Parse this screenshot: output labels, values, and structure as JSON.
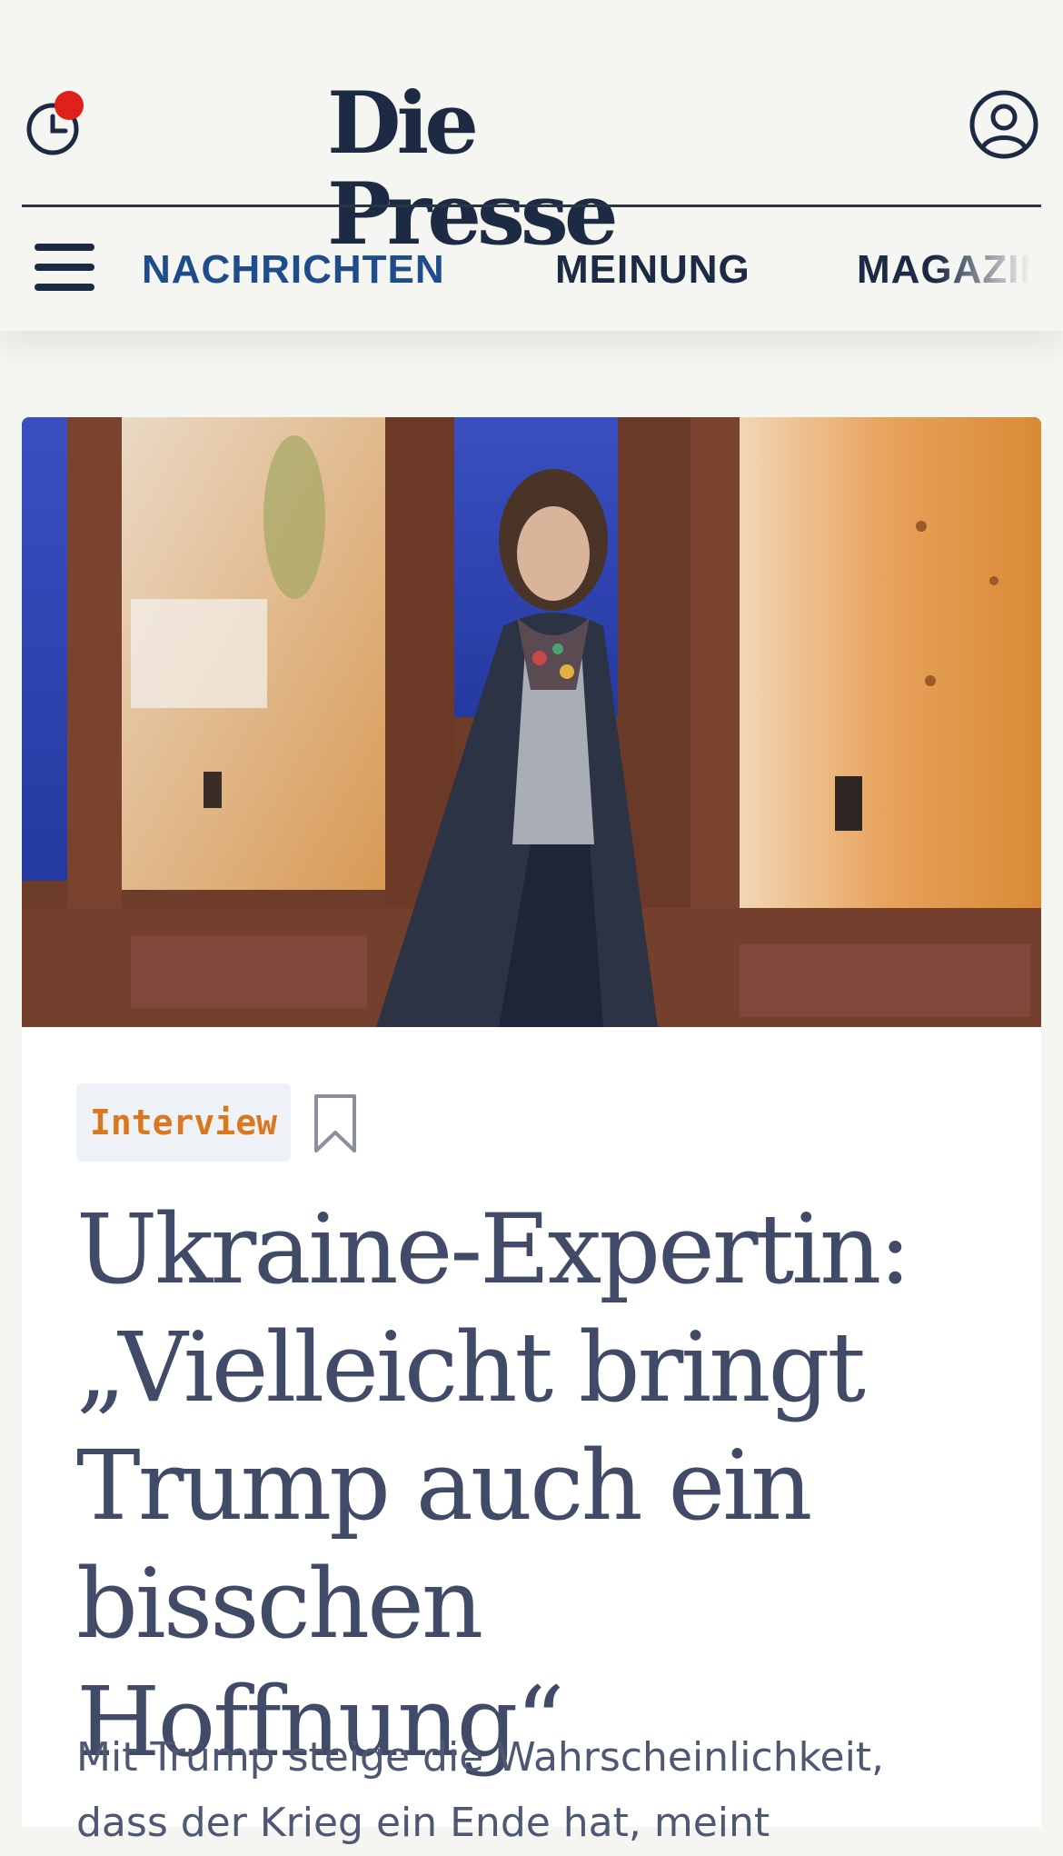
{
  "header": {
    "logo": "Die Presse",
    "icons": {
      "history": "clock-icon",
      "account": "user-circle-icon",
      "menu": "hamburger-menu-icon"
    },
    "colors": {
      "brand": "#1d2a44",
      "notification": "#e0201b",
      "active_nav": "#1f4d8c"
    }
  },
  "nav": {
    "items": [
      {
        "label": "NACHRICHTEN",
        "active": true
      },
      {
        "label": "MEINUNG",
        "active": false
      },
      {
        "label": "MAGAZIN",
        "active": false
      }
    ]
  },
  "article": {
    "tag": "Interview",
    "tag_color": "#d9781f",
    "bookmark_icon": "bookmark-icon",
    "headline": "Ukraine-Expertin: „Vielleicht bringt Trump auch ein bisschen Hoffnung“",
    "lead": "Mit Trump steige die Wahrscheinlichkeit, dass der Krieg ein Ende hat, meint"
  }
}
